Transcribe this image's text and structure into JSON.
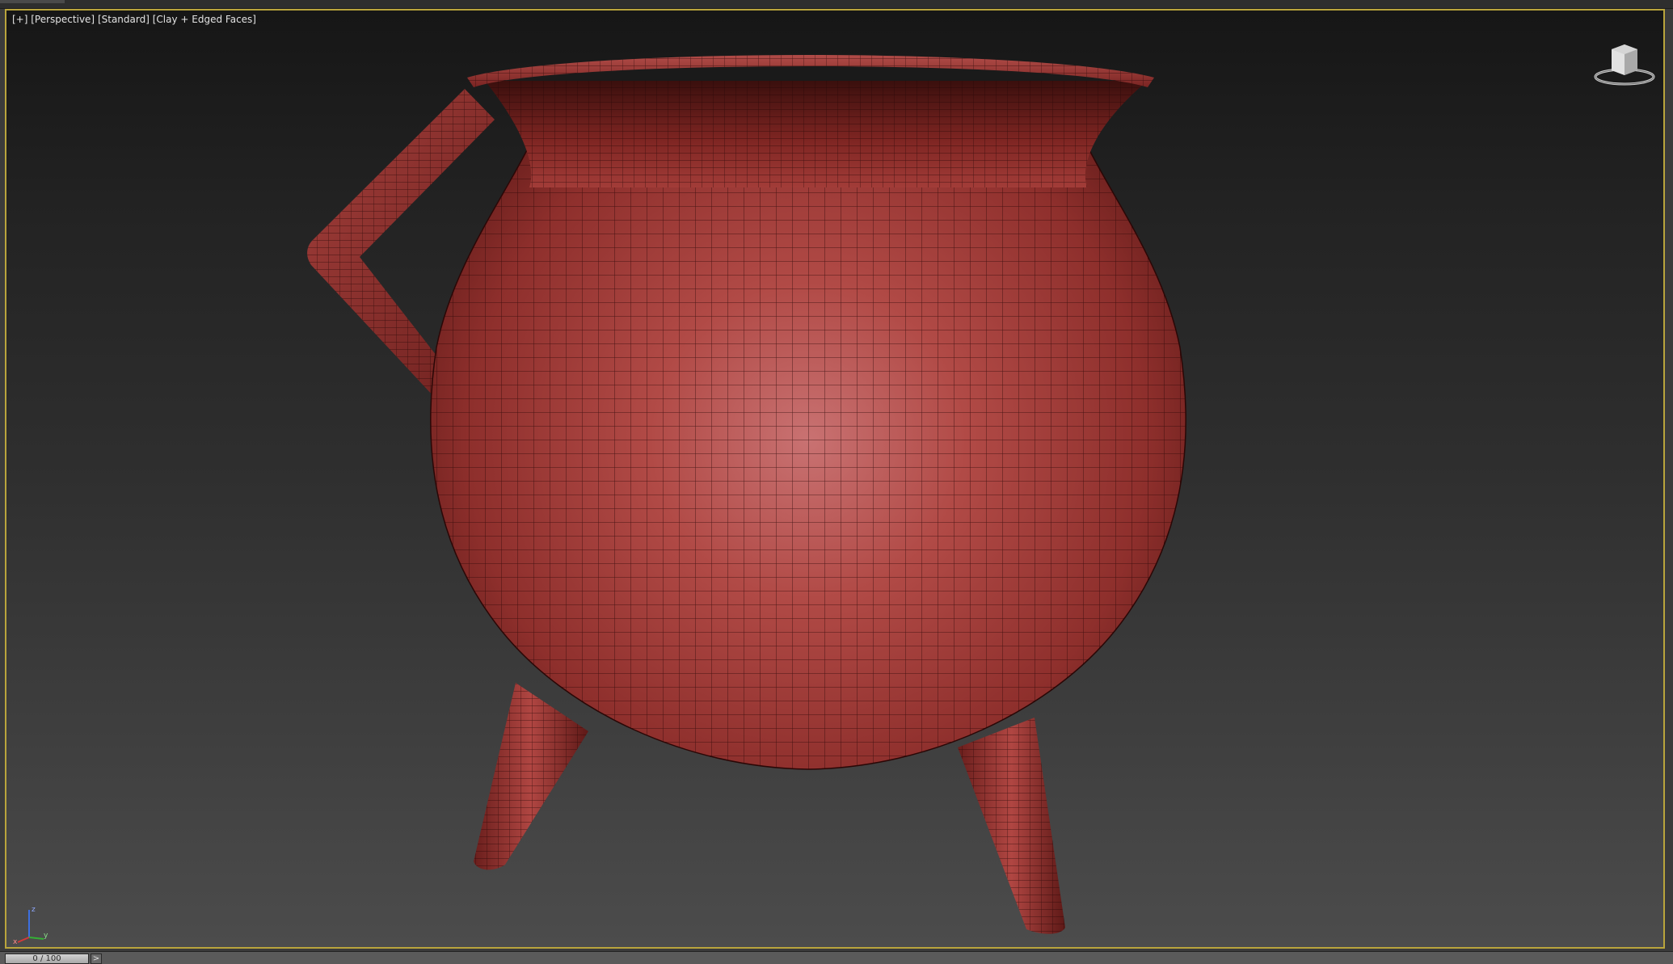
{
  "viewport": {
    "label_plus": "[+]",
    "label_view": "[Perspective]",
    "label_shading_style": "[Standard]",
    "label_display_mode": "[Clay + Edged Faces]",
    "border_color": "#b9a43c",
    "model_color": "#b54545"
  },
  "icons": {
    "viewcube": "viewcube-icon",
    "axis": "axis-tripod-icon"
  },
  "axis_labels": {
    "x": "x",
    "y": "y",
    "z": "z"
  },
  "timeline": {
    "frame_display": "0 / 100",
    "next_label": ">"
  }
}
